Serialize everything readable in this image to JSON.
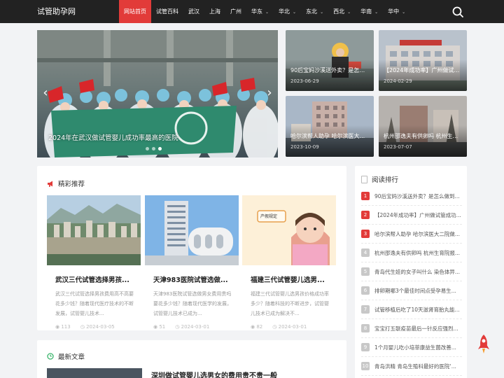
{
  "site": {
    "logo": "试管助孕网"
  },
  "nav": {
    "items": [
      {
        "label": "网站首页",
        "active": true,
        "dropdown": false
      },
      {
        "label": "试管百科",
        "active": false,
        "dropdown": false
      },
      {
        "label": "武汉",
        "active": false,
        "dropdown": false
      },
      {
        "label": "上海",
        "active": false,
        "dropdown": false
      },
      {
        "label": "广州",
        "active": false,
        "dropdown": false
      },
      {
        "label": "华东",
        "active": false,
        "dropdown": true
      },
      {
        "label": "华北",
        "active": false,
        "dropdown": true
      },
      {
        "label": "东北",
        "active": false,
        "dropdown": true
      },
      {
        "label": "西北",
        "active": false,
        "dropdown": true
      },
      {
        "label": "华南",
        "active": false,
        "dropdown": true
      },
      {
        "label": "华中",
        "active": false,
        "dropdown": true
      }
    ],
    "search_icon": "search-icon"
  },
  "hero": {
    "title": "2024年在武汉做试管婴儿成功率最高的医院",
    "slide_count": 3,
    "active_slide": 2
  },
  "thumbs": [
    {
      "title": "90后宝妈沙溪送外卖？是怎么...",
      "date": "2023-06-29"
    },
    {
      "title": "【2024年成功率】广州做试管...",
      "date": "2024-02-29"
    },
    {
      "title": "哈尔滨帮人助孕 哈尔滨医大...",
      "date": "2023-10-09"
    },
    {
      "title": "杭州邵逸夫有供卵吗 杭州生...",
      "date": "2023-07-07"
    }
  ],
  "recommend": {
    "title": "精彩推荐",
    "cards": [
      {
        "title": "武汉三代试管选择男孩...",
        "desc": "武汉三代试管选择男孩费用高不高要花多少钱？随着现代医疗技术的不断发展，试管婴儿技术...",
        "views": "113",
        "date": "2024-03-05"
      },
      {
        "title": "天津983医院试管选做...",
        "desc": "天津983医院试管选做男女费用贵吗要花多少钱？随着现代医学的发展，试管婴儿技术已成为...",
        "views": "51",
        "date": "2024-03-01"
      },
      {
        "title": "福建三代试管婴儿选男...",
        "desc": "福建三代试管婴儿选男孩价格成功率多少？随着科技的不断进步，试管婴儿技术已成为解决不...",
        "views": "82",
        "date": "2024-03-01",
        "bubble": "产假规定"
      }
    ]
  },
  "latest": {
    "title": "最新文章",
    "first_article_title": "深圳做试管婴儿选男女的费用贵不贵一般"
  },
  "ranking": {
    "title": "阅读排行",
    "items": [
      {
        "num": "1",
        "text": "90后宝妈沙溪送外卖？是怎么做到..."
      },
      {
        "num": "2",
        "text": "【2024年成功率】广州做试管成功..."
      },
      {
        "num": "3",
        "text": "哈尔滨帮人助孕 哈尔滨医大二院做..."
      },
      {
        "num": "4",
        "text": "杭州邵逸夫有供卵吗 杭州生育院报..."
      },
      {
        "num": "5",
        "text": "青岛代生娃的女子叫什么 染色体异..."
      },
      {
        "num": "6",
        "text": "排卵期哪3个最佳时间点受孕易生..."
      },
      {
        "num": "7",
        "text": "试管移植后吃了10天滋肾育胎丸能..."
      },
      {
        "num": "8",
        "text": "宝宝打五联疫苗最后一针反应强烈..."
      },
      {
        "num": "9",
        "text": "1个月婴儿吃小培菲康益生菌改善..."
      },
      {
        "num": "10",
        "text": "青岛洪精 青岛生殖科最好的医院‘..."
      }
    ]
  },
  "colors": {
    "accent": "#e23b39",
    "topbar": "#222222",
    "green_icon": "#3bb56c"
  }
}
